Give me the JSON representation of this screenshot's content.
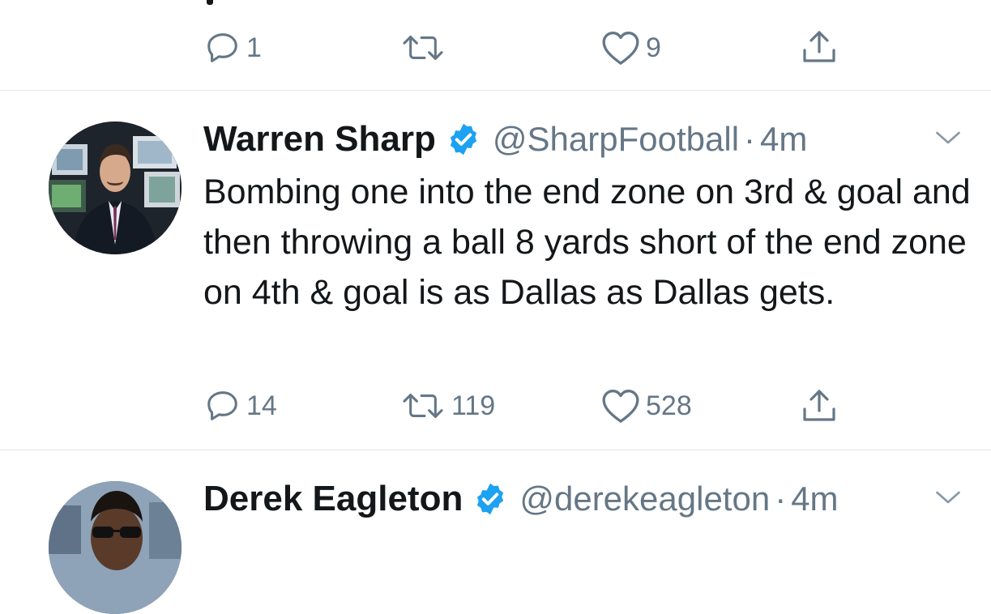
{
  "top_tweet": {
    "reply_count": "1",
    "retweet_count": "",
    "like_count": "9"
  },
  "main_tweet": {
    "name": "Warren Sharp",
    "handle": "@SharpFootball",
    "separator": "·",
    "time": "4m",
    "text": "Bombing one into the end zone on 3rd & goal and then throwing a ball 8 yards short of the end zone on 4th & goal is as Dallas as Dallas gets.",
    "reply_count": "14",
    "retweet_count": "119",
    "like_count": "528"
  },
  "next_tweet": {
    "name": "Derek Eagleton",
    "handle": "@derekeagleton",
    "separator": "·",
    "time": "4m"
  },
  "icons": {
    "reply": "reply-icon",
    "retweet": "retweet-icon",
    "like": "heart-icon",
    "share": "share-icon",
    "verified": "verified-badge-icon",
    "more": "chevron-down-icon"
  },
  "colors": {
    "text": "#14171a",
    "secondary": "#657786",
    "verified": "#1da1f2",
    "divider": "#e1e8ed"
  }
}
